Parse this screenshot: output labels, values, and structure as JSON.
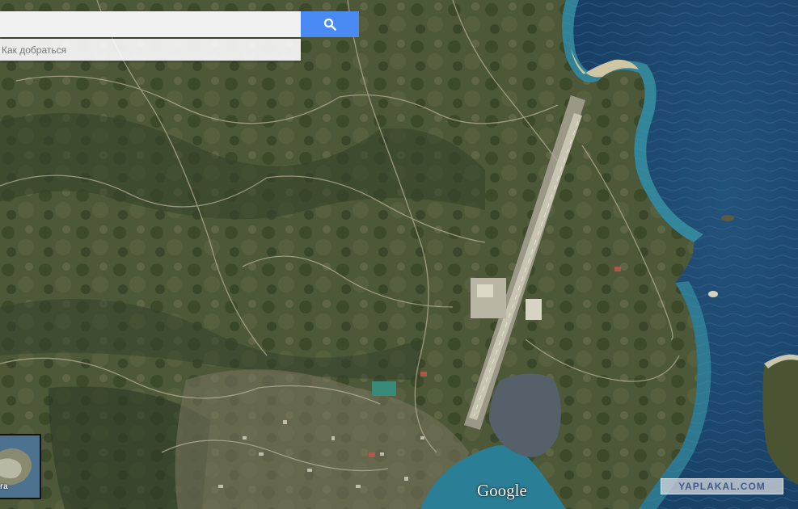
{
  "search": {
    "placeholder": "",
    "directions_label": "Как добраться"
  },
  "map": {
    "view": "satellite",
    "logo_text": "Google",
    "earth_thumbnail_label": "га"
  },
  "watermark": {
    "text": "YAPLAKAL.COM"
  },
  "colors": {
    "search_button": "#4a8af4",
    "sea": "#1f4f78",
    "land": "#4a5634"
  }
}
